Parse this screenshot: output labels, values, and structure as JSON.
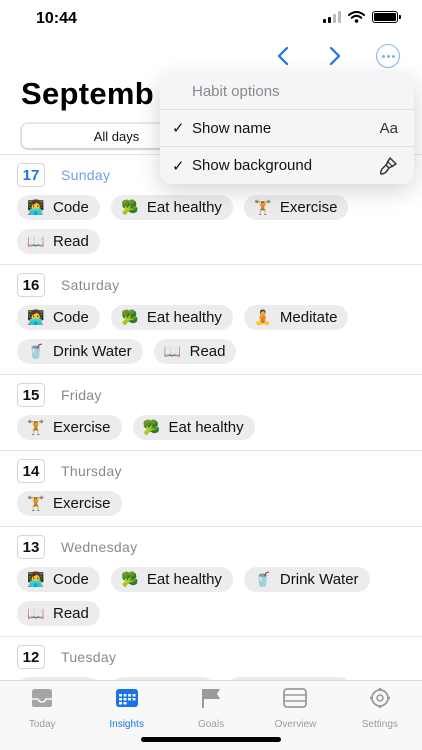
{
  "status": {
    "time": "10:44"
  },
  "header": {
    "title": "Septemb"
  },
  "filter": {
    "segments": [
      {
        "label": "All days"
      },
      {
        "label": ""
      }
    ]
  },
  "menu": {
    "title": "Habit options",
    "items": [
      {
        "label": "Show name",
        "trailing": "Aa",
        "checked": "✓"
      },
      {
        "label": "Show background",
        "trailing": "brush-icon",
        "checked": "✓"
      }
    ]
  },
  "days": [
    {
      "number": "17",
      "name": "Sunday",
      "today": true,
      "habits": [
        {
          "icon": "👩‍💻",
          "name": "Code"
        },
        {
          "icon": "🥦",
          "name": "Eat healthy"
        },
        {
          "icon": "🏋️",
          "name": "Exercise"
        },
        {
          "icon": "📖",
          "name": "Read"
        }
      ]
    },
    {
      "number": "16",
      "name": "Saturday",
      "habits": [
        {
          "icon": "👩‍💻",
          "name": "Code"
        },
        {
          "icon": "🥦",
          "name": "Eat healthy"
        },
        {
          "icon": "🧘",
          "name": "Meditate"
        },
        {
          "icon": "🥤",
          "name": "Drink Water"
        },
        {
          "icon": "📖",
          "name": "Read"
        }
      ]
    },
    {
      "number": "15",
      "name": "Friday",
      "habits": [
        {
          "icon": "🏋️",
          "name": "Exercise"
        },
        {
          "icon": "🥦",
          "name": "Eat healthy"
        }
      ]
    },
    {
      "number": "14",
      "name": "Thursday",
      "habits": [
        {
          "icon": "🏋️",
          "name": "Exercise"
        }
      ]
    },
    {
      "number": "13",
      "name": "Wednesday",
      "habits": [
        {
          "icon": "👩‍💻",
          "name": "Code"
        },
        {
          "icon": "🥦",
          "name": "Eat healthy"
        },
        {
          "icon": "🥤",
          "name": "Drink Water"
        },
        {
          "icon": "📖",
          "name": "Read"
        }
      ]
    },
    {
      "number": "12",
      "name": "Tuesday",
      "habits": [
        {
          "icon": "👩‍💻",
          "name": "Code"
        },
        {
          "icon": "🧘",
          "name": "Meditate"
        },
        {
          "icon": "🥤",
          "name": "Drink Water"
        }
      ]
    }
  ],
  "tabs": [
    {
      "label": "Today",
      "icon": "tray-icon"
    },
    {
      "label": "Insights",
      "icon": "calendar-grid-icon",
      "active": true
    },
    {
      "label": "Goals",
      "icon": "flag-icon"
    },
    {
      "label": "Overview",
      "icon": "overview-icon"
    },
    {
      "label": "Settings",
      "icon": "gear-icon"
    }
  ],
  "colors": {
    "accent": "#1a73e8",
    "chip_bg": "#ececef",
    "secondary_text": "#8a8a8e"
  }
}
